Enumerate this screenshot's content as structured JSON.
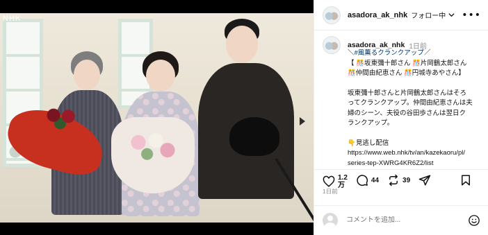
{
  "media": {
    "watermark": "NHK"
  },
  "header": {
    "username": "asadora_ak_nhk",
    "follow_label": "フォロー中",
    "more_label": "•••"
  },
  "caption": {
    "username": "asadora_ak_nhk",
    "time": "1日前",
    "lines": {
      "l1_prefix": "＼",
      "l1_hashtag": "#風薫るクランクアップ",
      "l1_suffix": "／",
      "l2": "【 🎊坂東彌十郎さん 🎊片岡鶴太郎さん",
      "l3": "🎊仲間由紀恵さん 🎊円城寺あやさん】",
      "l4": "坂東彌十郎さんと片岡鶴太郎さんはそろ",
      "l5": "ってクランクアップ。仲間由紀恵さんは夫",
      "l6": "婦のシーン、夫役の谷田歩さんは翌日ク",
      "l7": "ランクアップ。",
      "l8": "👇見逃し配信",
      "l9": "https://www.web.nhk/tv/an/kazekaoru/pl/",
      "l10": "series-tep-XWRG4KR6Z2/list"
    }
  },
  "actions": {
    "like_count_top": "1.2",
    "like_count_unit": "万",
    "comment_count": "44",
    "repost_count": "39",
    "posted_label": "1日前"
  },
  "comment": {
    "placeholder": "コメントを追加..."
  },
  "colors": {
    "hashtag": "#00376b",
    "muted": "#8e8e8e",
    "border": "#efefef"
  }
}
